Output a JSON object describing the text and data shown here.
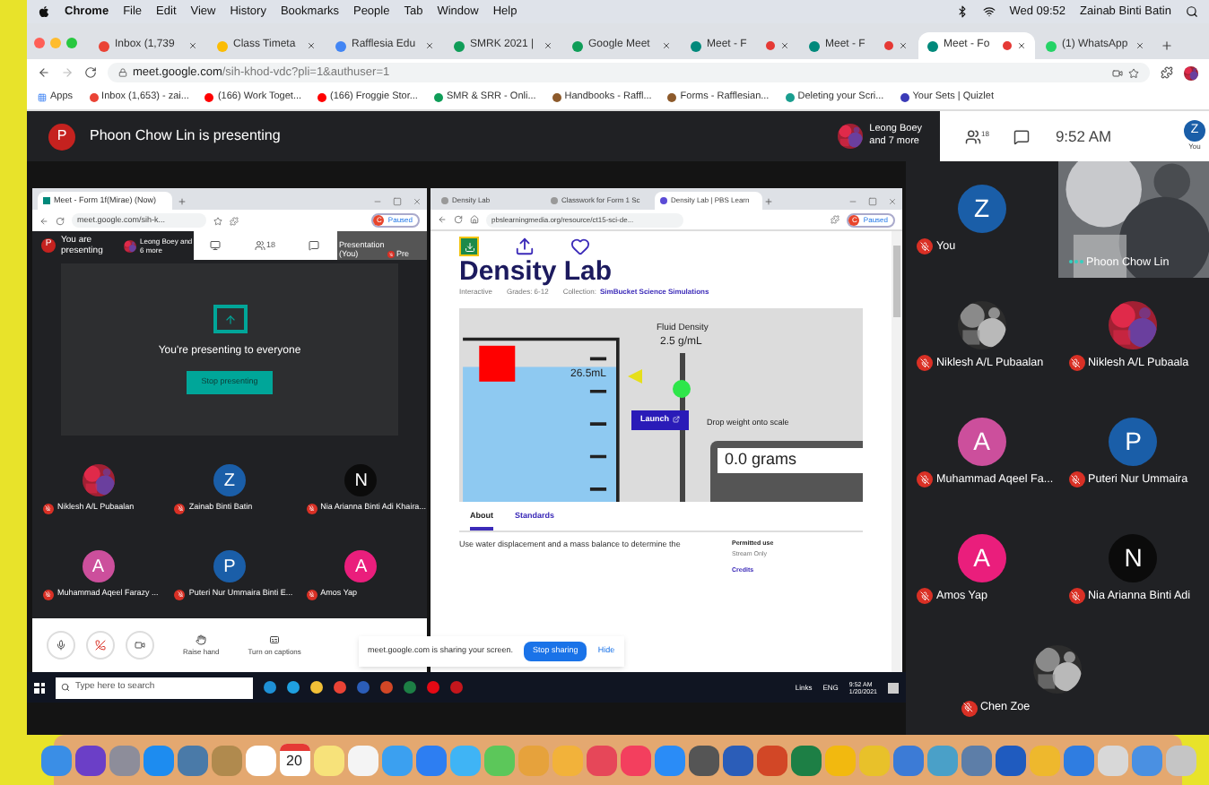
{
  "menu_bar": {
    "app": "Chrome",
    "menus": [
      "File",
      "Edit",
      "View",
      "History",
      "Bookmarks",
      "People",
      "Tab",
      "Window",
      "Help"
    ],
    "clock": "Wed 09:52",
    "user": "Zainab Binti Batin"
  },
  "browser": {
    "tabs": [
      {
        "title": "Inbox (1,739",
        "color": "#ea4335",
        "selected": false,
        "recording": false
      },
      {
        "title": "Class Timeta",
        "color": "#fbbc04",
        "selected": false,
        "recording": false
      },
      {
        "title": "Rafflesia Edu",
        "color": "#4285f4",
        "selected": false,
        "recording": false
      },
      {
        "title": "SMRK 2021 |",
        "color": "#0f9d58",
        "selected": false,
        "recording": false
      },
      {
        "title": "Google Meet",
        "color": "#0f9d58",
        "selected": false,
        "recording": false
      },
      {
        "title": "Meet - F",
        "color": "#00897b",
        "selected": false,
        "recording": true
      },
      {
        "title": "Meet - F",
        "color": "#00897b",
        "selected": false,
        "recording": true
      },
      {
        "title": "Meet - Fo",
        "color": "#00897b",
        "selected": true,
        "recording": true
      },
      {
        "title": "(1) WhatsApp",
        "color": "#25d366",
        "selected": false,
        "recording": false
      }
    ],
    "url_host": "meet.google.com",
    "url_path": "/sih-khod-vdc?pli=1&authuser=1",
    "bookmarks": [
      "Apps",
      "Inbox (1,653) - zai...",
      "(166) Work Toget...",
      "(166) Froggie Stor...",
      "SMR & SRR - Onli...",
      "Handbooks - Raffl...",
      "Forms - Rafflesian...",
      "Deleting your Scri...",
      "Your Sets | Quizlet"
    ]
  },
  "meet_header": {
    "presenter_initial": "P",
    "presenting_text": "Phoon Chow Lin is presenting",
    "viewers": [
      "Leong Boey",
      "and 7 more"
    ],
    "people_count": "18",
    "time": "9:52 AM",
    "self_initial": "Z",
    "self_label": "You"
  },
  "shared_screen": {
    "meet_window": {
      "tab": "Meet - Form 1f(Mirae) (Now)",
      "url": "meet.google.com/sih-k...",
      "profile": "C",
      "paused": "Paused",
      "presenter_initial": "P",
      "presenting_text": "You are presenting",
      "viewers": "Leong Boey and 6 more",
      "people_count": "18",
      "presentation_label": "Presentation (You)",
      "presentation_short": "Pre",
      "message": "You're presenting to everyone",
      "stop_button": "Stop presenting",
      "tiles": [
        {
          "name": "Niklesh A/L Pubaalan",
          "muted": true
        },
        {
          "name": "Zainab Binti Batin",
          "kind": "letter",
          "initial": "Z",
          "color": "#1a5ea8",
          "muted": true
        },
        {
          "name": "Nia Arianna Binti Adi Khaira...",
          "kind": "letter",
          "initial": "N",
          "color": "#0b0b0b",
          "muted": true
        },
        {
          "name": "Muhammad Aqeel Farazy ...",
          "kind": "letter",
          "initial": "A",
          "color": "#cc4f9c",
          "muted": true
        },
        {
          "name": "Puteri Nur Ummaira Binti E...",
          "kind": "letter",
          "initial": "P",
          "color": "#1a5ea8",
          "muted": true
        },
        {
          "name": "Amos Yap",
          "kind": "letter",
          "initial": "A",
          "color": "#ea1e7c",
          "muted": true
        }
      ],
      "controls": [
        "Raise hand",
        "Turn on captions"
      ]
    },
    "lab_window": {
      "tabs": [
        {
          "title": "Density Lab",
          "selected": false
        },
        {
          "title": "Classwork for Form 1 Sc",
          "selected": false
        },
        {
          "title": "Density Lab | PBS Learn",
          "selected": true
        }
      ],
      "url": "pbslearningmedia.org/resource/ct15-sci-de...",
      "profile": "C",
      "paused": "Paused",
      "title": "Density Lab",
      "meta": [
        "Interactive",
        "Grades: 6-12",
        "Collection:"
      ],
      "collection": "SimBucket Science Simulations",
      "sim": {
        "density_label": "Fluid Density",
        "density_value": "2.5 g/mL",
        "volume": "26.5mL",
        "launch": "Launch",
        "scale_hint": "Drop weight onto scale",
        "reading": "0.0 grams"
      },
      "page_tabs": [
        {
          "label": "About",
          "selected": true
        },
        {
          "label": "Standards",
          "selected": false
        }
      ],
      "description": "Use water displacement and a mass balance to determine the",
      "side": [
        "Permitted use",
        "Stream Only",
        "Credits"
      ]
    },
    "notice": {
      "text": "meet.google.com is sharing your screen.",
      "stop": "Stop sharing",
      "hide": "Hide"
    },
    "taskbar": {
      "search_placeholder": "Type here to search",
      "links": "Links",
      "lang": "ENG",
      "time": "9:52 AM",
      "date": "1/20/2021"
    }
  },
  "participants": [
    {
      "name": "You",
      "kind": "letter",
      "initial": "Z",
      "color": "#1a5ea8",
      "muted": true
    },
    {
      "name": "Phoon Chow Lin",
      "kind": "video",
      "muted": false
    },
    {
      "name": "Niklesh A/L Pubaalan",
      "muted": true
    },
    {
      "name": "Niklesh A/L Pubaala",
      "muted": true
    },
    {
      "name": "Muhammad Aqeel Fa...",
      "kind": "letter",
      "initial": "A",
      "color": "#cc4f9c",
      "muted": true
    },
    {
      "name": "Puteri Nur Ummaira",
      "kind": "letter",
      "initial": "P",
      "color": "#1a5ea8",
      "muted": true
    },
    {
      "name": "Amos Yap",
      "kind": "letter",
      "initial": "A",
      "color": "#ea1e7c",
      "muted": true
    },
    {
      "name": "Nia Arianna Binti Adi",
      "kind": "letter",
      "initial": "N",
      "color": "#0b0b0b",
      "muted": true
    },
    {
      "name": "Chen Zoe",
      "muted": true
    }
  ],
  "dock": {
    "calendar_day": "20"
  }
}
